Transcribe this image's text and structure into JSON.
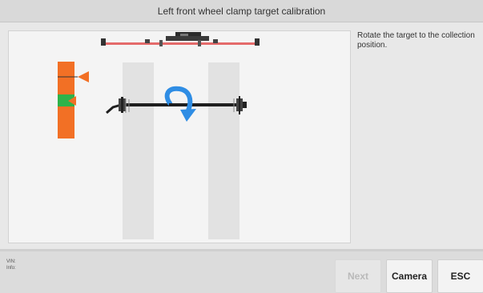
{
  "header": {
    "title": "Left front wheel clamp target calibration"
  },
  "instruction": {
    "text": "Rotate the target to the collection position."
  },
  "footer": {
    "vin_label": "VIN:",
    "info_label": "Info:",
    "buttons": {
      "next": "Next",
      "camera": "Camera",
      "esc": "ESC"
    }
  },
  "colors": {
    "target_orange": "#f27025",
    "target_green": "#2eb34a",
    "rotate_arrow": "#2f8de4",
    "beam_red": "#e46a6a",
    "lane_gray": "#e2e2e2",
    "disabled_text": "#b9b9b9"
  },
  "icons": [
    "rotate-arrow-icon"
  ]
}
